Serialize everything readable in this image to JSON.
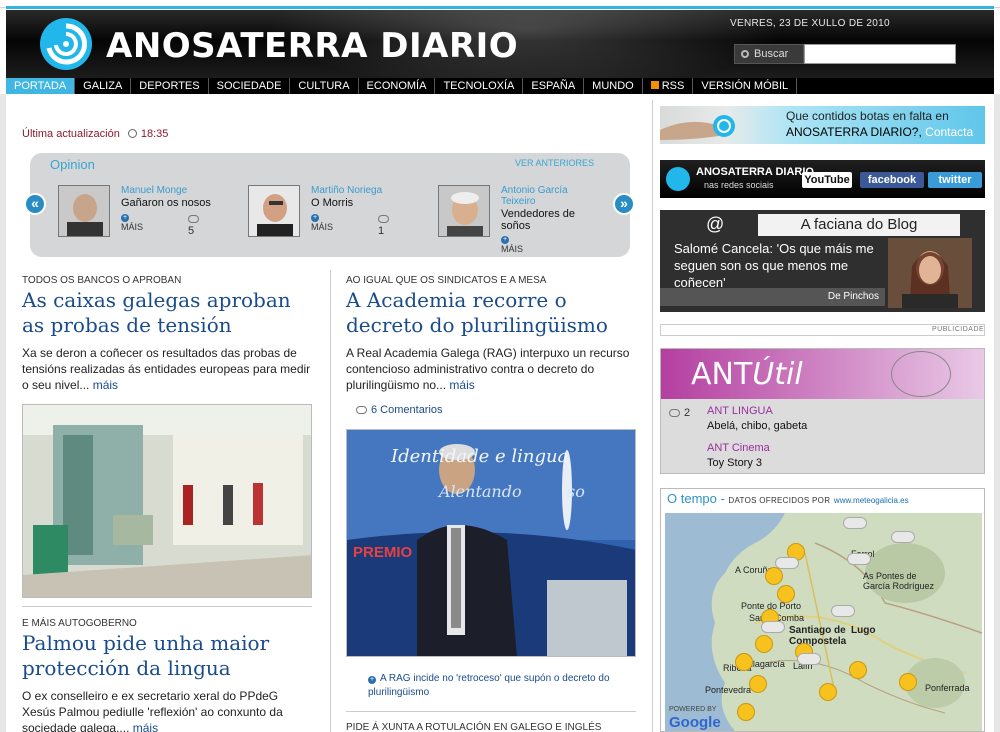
{
  "header": {
    "logo_text": "ANOSATERRA DIARIO",
    "date": "VENRES, 23 DE XULLO DE 2010",
    "search_button": "Buscar",
    "search_placeholder": ""
  },
  "nav": {
    "items": [
      "PORTADA",
      "GALIZA",
      "DEPORTES",
      "SOCIEDADE",
      "CULTURA",
      "ECONOMÍA",
      "TECNOLOXÍA",
      "ESPAÑA",
      "MUNDO",
      "RSS",
      "VERSIÓN MÓBIL"
    ],
    "active": "PORTADA"
  },
  "updated": {
    "label": "Última actualización",
    "time": "18:35"
  },
  "opinion": {
    "title": "Opinion",
    "see_previous": "VER ANTERIORES",
    "authors": [
      {
        "name": "Manuel Monge",
        "headline": "Gañaron os nosos",
        "more": "MÁIS",
        "comments": "5"
      },
      {
        "name": "Martiño Noriega",
        "headline": "O Morris",
        "more": "MÁIS",
        "comments": "1"
      },
      {
        "name_line1": "Antonio García",
        "name_line2": "Teixeiro",
        "headline_line1": "Vendedores de",
        "headline_line2": "soños",
        "more": "MÁIS"
      }
    ]
  },
  "articles": {
    "a1": {
      "kicker": "TODOS OS BANCOS O APROBAN",
      "headline_line1": "As caixas galegas aproban",
      "headline_line2": "as probas de tensión",
      "summary": "Xa se deron a coñecer os resultados das probas de tensións realizadas ás entidades europeas para medir o seu nivel...",
      "more": "máis"
    },
    "a2": {
      "kicker": "AO IGUAL QUE OS SINDICATOS E A MESA",
      "headline_line1": "A Academia recorre o",
      "headline_line2": "decreto do plurilingüismo",
      "summary": "A Real Academia Galega (RAG) interpuxo un recurso contencioso administrativo contra o decreto do plurilingüismo no...",
      "more": "máis",
      "comments": "6 Comentarios",
      "photo_text_1": "Identidade e lingua",
      "photo_text_2": "Alentando",
      "photo_text_3": "so",
      "photo_text_4": "PREMIO",
      "related": "A RAG incide no 'retroceso' que supón o decreto do plurilingüismo"
    },
    "a3": {
      "kicker": "E MÁIS AUTOGOBERNO",
      "headline_line1": "Palmou pide unha maior",
      "headline_line2": "protección da lingua",
      "summary": "O ex conselleiro e ex secretario xeral do PPdeG Xesús Palmou pediulle 'reflexión' ao conxunto da sociedade galega....",
      "more": "máis"
    },
    "a4": {
      "kicker": "PIDE Á XUNTA A ROTULACIÓN EN GALEGO E INGLÉS"
    }
  },
  "sidebar": {
    "banner_contact": {
      "line1": "Que contidos botas en falta en",
      "line2": "ANOSATERRA DIARIO?,",
      "link": "Contacta"
    },
    "banner_social": {
      "brand": "ANOSATERRA DIARIO",
      "sub": "nas redes sociais",
      "youtube": "YouTube",
      "facebook": "facebook",
      "twitter": "twitter"
    },
    "blog": {
      "at": "@",
      "tag": "A faciana do Blog",
      "quote": "Salomé Cancela: 'Os que máis me seguen son os que menos me coñecen'",
      "source": "De Pinchos"
    },
    "publicidade": "PUBLICIDADE",
    "antutil": {
      "logo_ant": "ANT",
      "logo_util": "Útil",
      "comments": "2",
      "items": [
        {
          "cat": "ANT LINGUA",
          "text": "Abelá, chibo, gabeta"
        },
        {
          "cat": "ANT Cinema",
          "text": "Toy Story 3"
        }
      ]
    },
    "weather": {
      "title": "O tempo -",
      "sub": "DATOS OFRECIDOS POR",
      "link": "www.meteogalicia.es",
      "powered": "POWERED BY",
      "google": "Google",
      "towns": [
        "A Coruña",
        "Ponte do Porto",
        "Santa Comba",
        "Santiago de Compostela",
        "Lugo",
        "Ribeira",
        "Vilagarcía",
        "Lalín",
        "Pontevedra",
        "Ponferrada",
        "Ferrol",
        "As Pontes de García Rodríguez"
      ]
    }
  }
}
